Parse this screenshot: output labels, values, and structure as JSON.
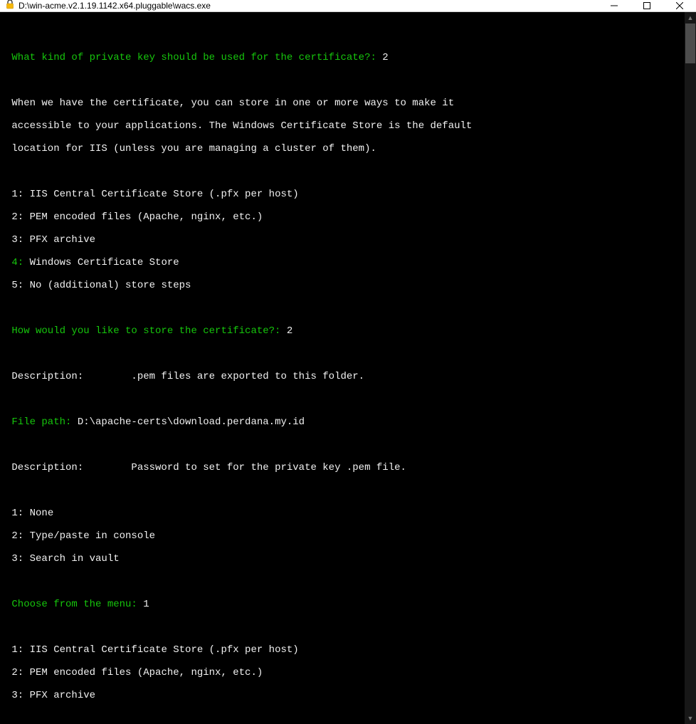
{
  "window": {
    "title": "D:\\win-acme.v2.1.19.1142.x64.pluggable\\wacs.exe"
  },
  "console": {
    "q1_label": " What kind of private key should be used for the certificate?:",
    "q1_answer": " 2",
    "info1_l1": " When we have the certificate, you can store in one or more ways to make it",
    "info1_l2": " accessible to your applications. The Windows Certificate Store is the default",
    "info1_l3": " location for IIS (unless you are managing a cluster of them).",
    "store_opts": {
      "1": "1: IIS Central Certificate Store (.pfx per host)",
      "2": "2: PEM encoded files (Apache, nginx, etc.)",
      "3": "3: PFX archive",
      "4_num": " 4:",
      "4_txt": " Windows Certificate Store",
      "5": "5: No (additional) store steps"
    },
    "q2_label": " How would you like to store the certificate?:",
    "q2_answer": " 2",
    "desc_label1": " Description:",
    "desc_txt1": "        .pem files are exported to this folder.",
    "filepath_label": " File path:",
    "filepath_val": " D:\\apache-certs\\download.perdana.my.id",
    "desc_label2": " Description:",
    "desc_txt2": "        Password to set for the private key .pem file.",
    "pw_opts": {
      "1": "1: None",
      "2": "2: Type/paste in console",
      "3": "3: Search in vault"
    },
    "q3_label": " Choose from the menu:",
    "q3_answer": " 1",
    "store_opts2": {
      "1": "1: IIS Central Certificate Store (.pfx per host)",
      "2": "2: PEM encoded files (Apache, nginx, etc.)",
      "3": "3: PFX archive"
    }
  }
}
